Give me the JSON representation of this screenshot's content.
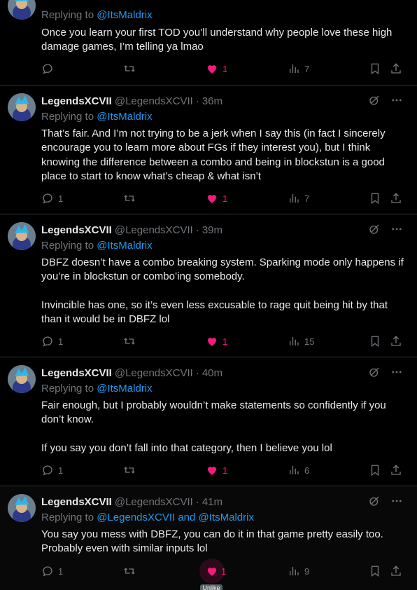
{
  "colors": {
    "background": "#000000",
    "text": "#e7e9ea",
    "muted": "#71767b",
    "link": "#1d9bf0",
    "like": "#f91880",
    "border": "#2f3336"
  },
  "tweets": [
    {
      "replying_prefix": "Replying to ",
      "replying_to": "@ItsMaldrix",
      "text": "Once you learn your first TOD you’ll understand why people love these high damage games, I’m telling ya lmao",
      "replies": "",
      "retweets": "",
      "likes": "1",
      "views": "7"
    },
    {
      "name": "LegendsXCVII",
      "handle": "@LegendsXCVII",
      "time": "36m",
      "replying_prefix": "Replying to ",
      "replying_to": "@ItsMaldrix",
      "text": "That’s fair. And I’m not trying to be a jerk when I say this (in fact I sincerely encourage you to learn more about FGs if they interest you), but I think knowing the difference between a combo and being in blockstun is a good place to start to know what’s cheap & what isn’t",
      "replies": "1",
      "retweets": "",
      "likes": "1",
      "views": "7"
    },
    {
      "name": "LegendsXCVII",
      "handle": "@LegendsXCVII",
      "time": "39m",
      "replying_prefix": "Replying to ",
      "replying_to": "@ItsMaldrix",
      "text": "DBFZ doesn’t have a combo breaking system. Sparking mode only happens if you’re in blockstun or combo’ing somebody.\n\nInvincible has one, so it’s even less excusable to rage quit being hit by that than it would be in DBFZ lol",
      "replies": "1",
      "retweets": "",
      "likes": "1",
      "views": "15"
    },
    {
      "name": "LegendsXCVII",
      "handle": "@LegendsXCVII",
      "time": "40m",
      "replying_prefix": "Replying to ",
      "replying_to": "@ItsMaldrix",
      "text": "Fair enough, but I probably wouldn’t make statements so confidently if you don’t know.\n\nIf you say you don’t fall into that category, then I believe you lol",
      "replies": "1",
      "retweets": "",
      "likes": "1",
      "views": "6"
    },
    {
      "name": "LegendsXCVII",
      "handle": "@LegendsXCVII",
      "time": "41m",
      "replying_prefix": "Replying to ",
      "replying_to": "@LegendsXCVII and @ItsMaldrix",
      "text": "You say you mess with DBFZ, you can do it in that game pretty easily too. Probably even with similar inputs lol",
      "replies": "1",
      "retweets": "",
      "likes": "1",
      "views": "9"
    }
  ],
  "tooltip": "Unlike",
  "separator": "·"
}
